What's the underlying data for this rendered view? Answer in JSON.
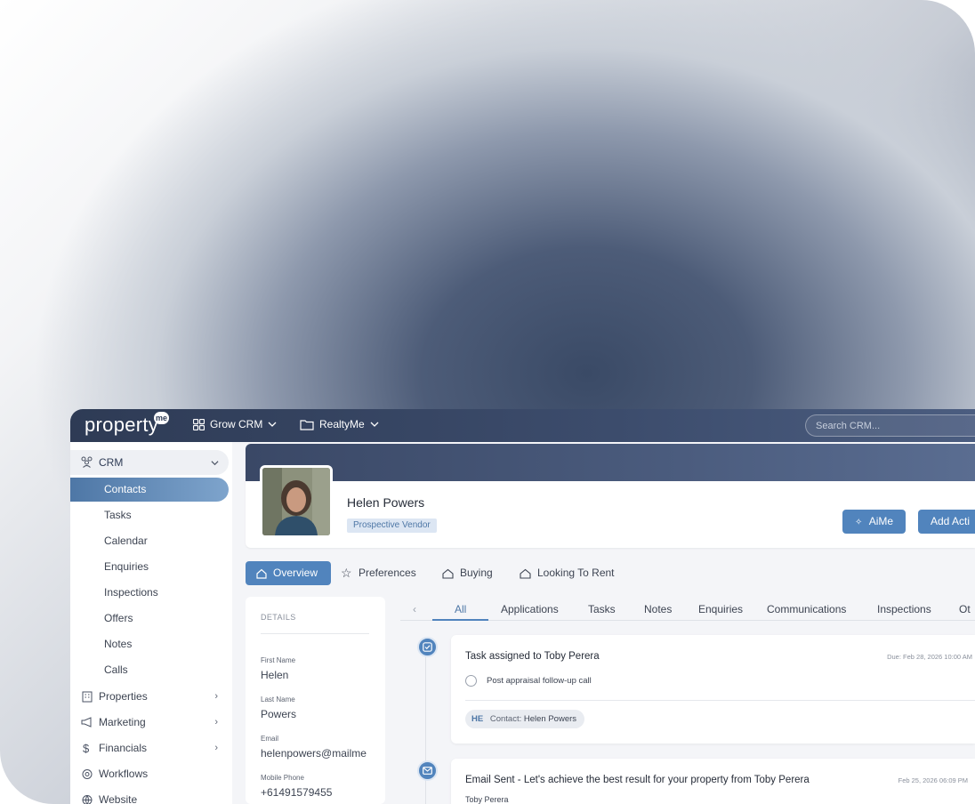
{
  "brand": {
    "logo_text": "property",
    "logo_badge": "me"
  },
  "topbar": {
    "menu_grow": "Grow CRM",
    "menu_agency": "RealtyMe",
    "search_placeholder": "Search CRM..."
  },
  "sidebar": {
    "section_label": "CRM",
    "items": [
      "Contacts",
      "Tasks",
      "Calendar",
      "Enquiries",
      "Inspections",
      "Offers",
      "Notes",
      "Calls"
    ],
    "active_item": "Contacts",
    "parents": [
      "Properties",
      "Marketing",
      "Financials",
      "Workflows",
      "Website"
    ]
  },
  "contact": {
    "name": "Helen Powers",
    "badge": "Prospective Vendor"
  },
  "actions": {
    "aime": "AiMe",
    "add_activity": "Add Acti"
  },
  "profile_tabs": [
    "Overview",
    "Preferences",
    "Buying",
    "Looking To Rent"
  ],
  "details": {
    "title": "DETAILS",
    "fields": [
      {
        "label": "First Name",
        "value": "Helen"
      },
      {
        "label": "Last Name",
        "value": "Powers"
      },
      {
        "label": "Email",
        "value": "helenpowers@mailme"
      },
      {
        "label": "Mobile Phone",
        "value": "+61491579455"
      }
    ]
  },
  "activity_tabs": [
    "All",
    "Applications",
    "Tasks",
    "Notes",
    "Enquiries",
    "Communications",
    "Inspections",
    "Ot"
  ],
  "timeline": {
    "task": {
      "title": "Task assigned to Toby Perera",
      "due": "Due: Feb 28, 2026 10:00 AM",
      "item": "Post appraisal follow-up call",
      "chip_initials": "HE",
      "chip_prefix": "Contact:",
      "chip_name": "Helen Powers"
    },
    "email": {
      "title": "Email Sent - Let's achieve the best result for your property from Toby Perera",
      "date": "Feb 25, 2026 06:09 PM",
      "sender": "Toby Perera"
    }
  },
  "colors": {
    "accent": "#5184bd",
    "topbar": "#2e3b55"
  }
}
